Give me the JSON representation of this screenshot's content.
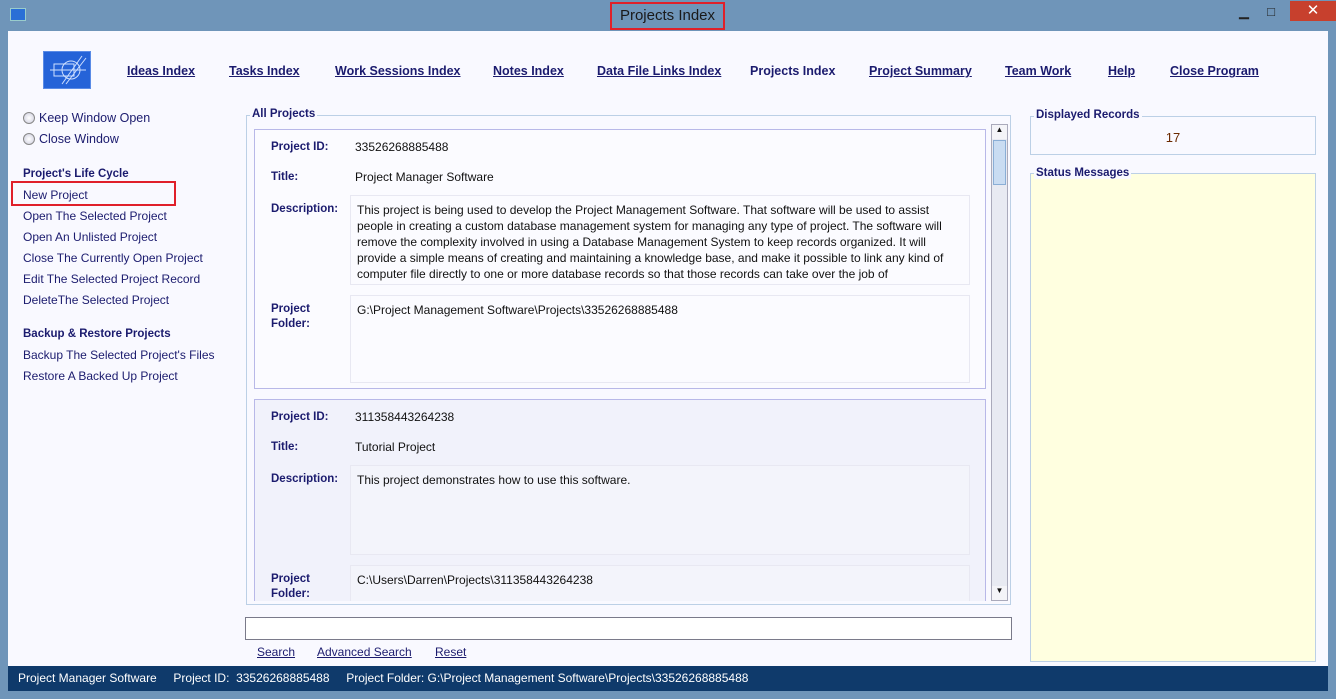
{
  "window": {
    "title": "Projects Index",
    "minimize": "▁",
    "maximize": "□",
    "close": "✕"
  },
  "nav": [
    "Ideas Index",
    "Tasks Index",
    "Work Sessions Index",
    "Notes Index",
    "Data File Links Index",
    "Projects Index",
    "Project Summary",
    "Team Work",
    "Help",
    "Close Program"
  ],
  "options": {
    "keep_open": "Keep Window Open",
    "close_window": "Close Window"
  },
  "lifecycle": {
    "heading": "Project's Life Cycle",
    "items": [
      "New Project",
      "Open The Selected Project",
      "Open An Unlisted Project",
      "Close The Currently Open Project",
      "Edit The Selected Project Record",
      "DeleteThe Selected Project"
    ]
  },
  "backup": {
    "heading": "Backup & Restore Projects",
    "items": [
      "Backup The Selected Project's Files",
      "Restore A Backed Up Project"
    ]
  },
  "projects": {
    "heading": "All Projects",
    "labels": {
      "id": "Project ID:",
      "title": "Title:",
      "description": "Description:",
      "folder1": "Project",
      "folder2": "Folder:"
    },
    "records": [
      {
        "id": "33526268885488",
        "title": "Project Manager Software",
        "description": "This project is being used to develop the Project Management Software. That software will be used to assist people in creating a custom database management system for managing any type of project. The software will remove the complexity involved in using a Database Management System to keep records organized. It will provide a simple means of creating and maintaining a knowledge base, and make it possible to link any kind of computer file directly to one or more database records so that those records can take over the job of",
        "folder": "G:\\Project Management Software\\Projects\\33526268885488"
      },
      {
        "id": "311358443264238",
        "title": "Tutorial Project",
        "description": "This project demonstrates how to use this software.",
        "folder": "C:\\Users\\Darren\\Projects\\311358443264238"
      }
    ]
  },
  "search": {
    "value": "",
    "search": "Search",
    "advanced": "Advanced Search",
    "reset": "Reset"
  },
  "displayed": {
    "heading": "Displayed Records",
    "count": "17"
  },
  "status_messages": {
    "heading": "Status Messages"
  },
  "statusbar": {
    "text": "Project Manager Software     Project ID:  33526268885488     Project Folder: G:\\Project Management Software\\Projects\\33526268885488"
  }
}
